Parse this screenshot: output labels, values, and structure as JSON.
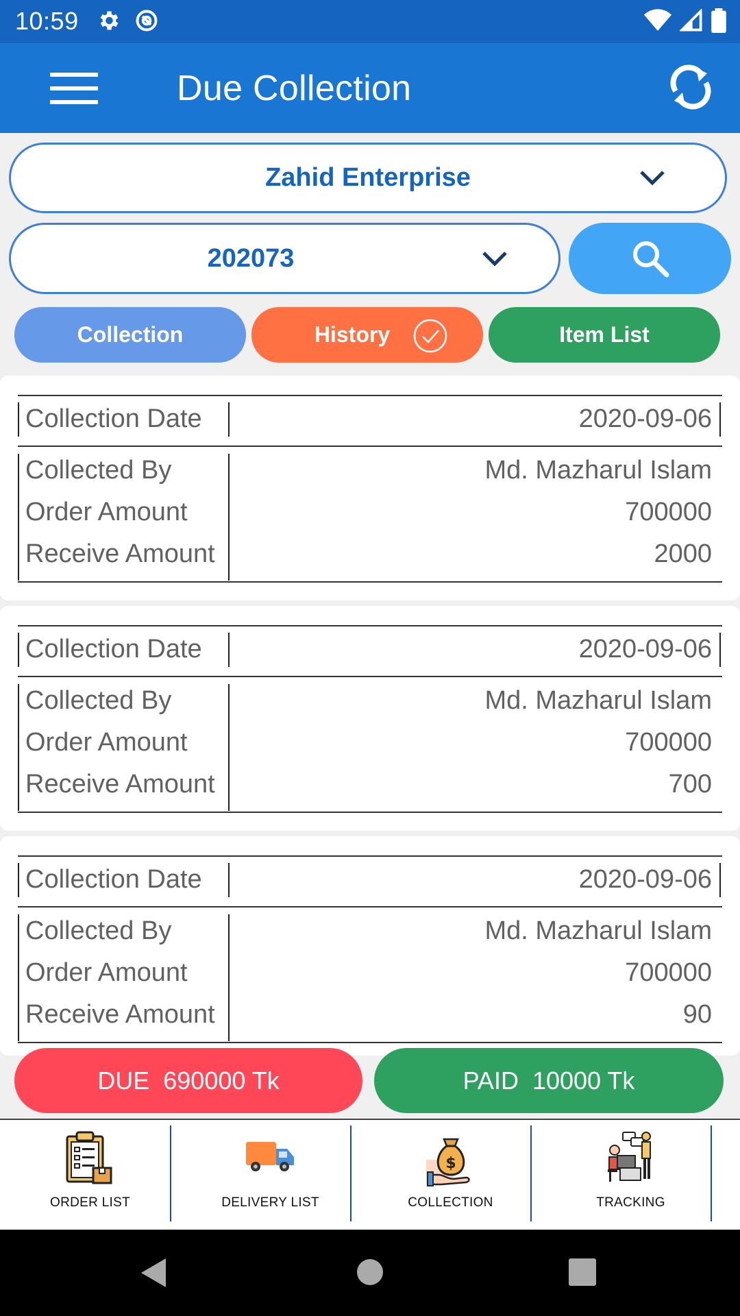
{
  "status_bar": {
    "time": "10:59"
  },
  "app_bar": {
    "title": "Due Collection"
  },
  "filters": {
    "customer": "Zahid Enterprise",
    "order_no": "202073"
  },
  "tabs": {
    "collection": "Collection",
    "history": "History",
    "item_list": "Item List"
  },
  "labels": {
    "collection_date": "Collection Date",
    "collected_by": "Collected By",
    "order_amount": "Order Amount",
    "receive_amount": "Receive Amount"
  },
  "records": [
    {
      "collection_date": "2020-09-06",
      "collected_by": "Md. Mazharul Islam",
      "order_amount": "700000",
      "receive_amount": "2000"
    },
    {
      "collection_date": "2020-09-06",
      "collected_by": "Md. Mazharul Islam",
      "order_amount": "700000",
      "receive_amount": "700"
    },
    {
      "collection_date": "2020-09-06",
      "collected_by": "Md. Mazharul Islam",
      "order_amount": "700000",
      "receive_amount": "90"
    }
  ],
  "summary": {
    "due": "DUE  690000 Tk",
    "paid": "PAID  10000 Tk"
  },
  "bottom_nav": [
    {
      "label": "ORDER LIST",
      "icon": "clipboard-list-icon"
    },
    {
      "label": "DELIVERY LIST",
      "icon": "delivery-truck-icon"
    },
    {
      "label": "COLLECTION",
      "icon": "money-bag-icon"
    },
    {
      "label": "TRACKING",
      "icon": "tracking-people-icon"
    }
  ],
  "colors": {
    "primary": "#1976d2",
    "collection_tab": "#6699e8",
    "history_tab": "#ff7043",
    "item_tab": "#2ea05f",
    "due": "#ff4757",
    "paid": "#2ea05f"
  }
}
